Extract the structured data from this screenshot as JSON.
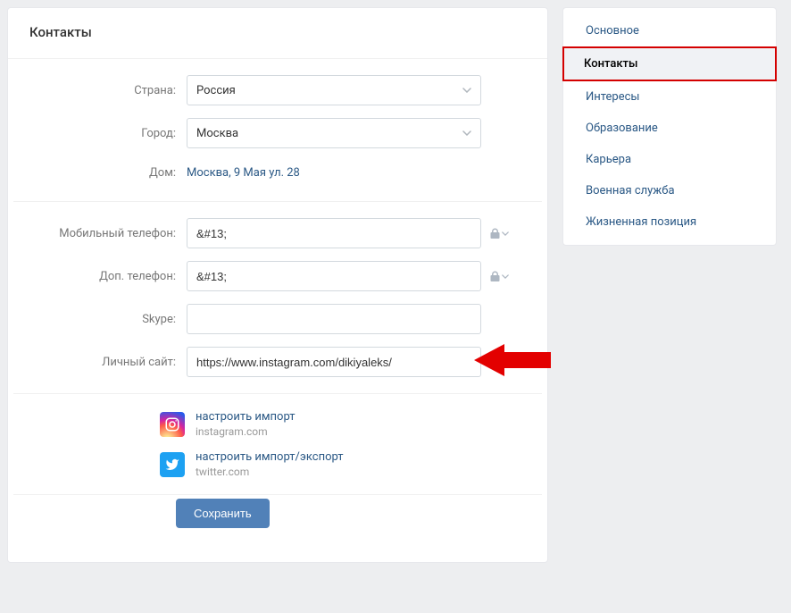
{
  "page": {
    "title": "Контакты"
  },
  "form": {
    "country": {
      "label": "Страна:",
      "value": "Россия"
    },
    "city": {
      "label": "Город:",
      "value": "Москва"
    },
    "home": {
      "label": "Дом:",
      "value": "Москва, 9 Мая ул. 28"
    },
    "mobile": {
      "label": "Мобильный телефон:",
      "value": "&#13;"
    },
    "alt_phone": {
      "label": "Доп. телефон:",
      "value": "&#13;"
    },
    "skype": {
      "label": "Skype:",
      "value": ""
    },
    "website": {
      "label": "Личный сайт:",
      "value": "https://www.instagram.com/dikiyaleks/"
    }
  },
  "integrations": {
    "instagram": {
      "link": "настроить импорт",
      "sub": "instagram.com"
    },
    "twitter": {
      "link": "настроить импорт/экспорт",
      "sub": "twitter.com"
    }
  },
  "actions": {
    "save": "Сохранить"
  },
  "sidebar": {
    "items": [
      {
        "label": "Основное",
        "active": false
      },
      {
        "label": "Контакты",
        "active": true
      },
      {
        "label": "Интересы",
        "active": false
      },
      {
        "label": "Образование",
        "active": false
      },
      {
        "label": "Карьера",
        "active": false
      },
      {
        "label": "Военная служба",
        "active": false
      },
      {
        "label": "Жизненная позиция",
        "active": false
      }
    ]
  }
}
